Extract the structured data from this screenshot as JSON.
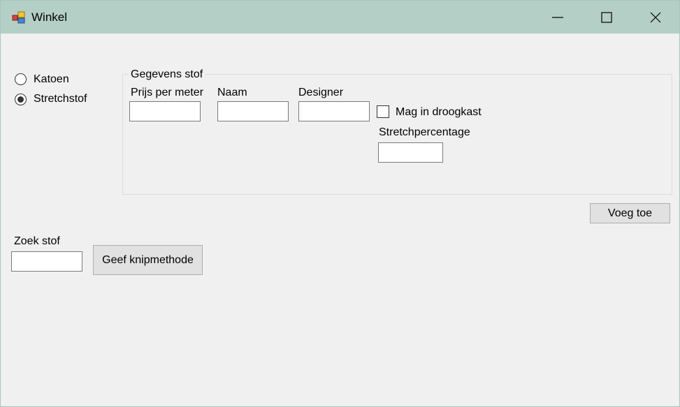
{
  "window": {
    "title": "Winkel"
  },
  "titlebar": {
    "minimize_glyph": "—",
    "maximize_glyph": "☐",
    "close_glyph": "✕"
  },
  "radio_options": [
    {
      "label": "Katoen",
      "checked": false
    },
    {
      "label": "Stretchstof",
      "checked": true
    }
  ],
  "group": {
    "title": "Gegevens stof",
    "prijs_label": "Prijs per meter",
    "prijs_value": "",
    "naam_label": "Naam",
    "naam_value": "",
    "designer_label": "Designer",
    "designer_value": "",
    "droogkast_label": "Mag in droogkast",
    "droogkast_checked": false,
    "stretch_label": "Stretchpercentage",
    "stretch_value": ""
  },
  "buttons": {
    "voeg_toe": "Voeg toe",
    "geef_knipmethode": "Geef knipmethode"
  },
  "search": {
    "label": "Zoek stof",
    "value": ""
  }
}
